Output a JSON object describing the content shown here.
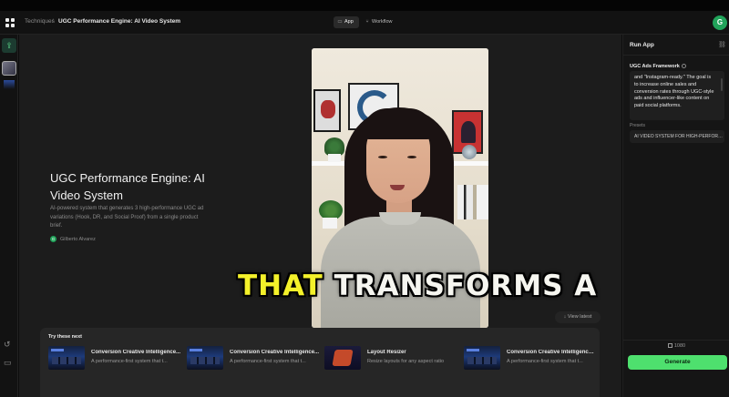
{
  "header": {
    "breadcrumb_parent": "Techniques",
    "breadcrumb_sep": "/",
    "breadcrumb_current": "UGC Performance Engine: AI Video System",
    "tabs": [
      {
        "label": "App",
        "icon": "phone-icon"
      },
      {
        "label": "Workflow",
        "icon": "workflow-icon"
      }
    ],
    "avatar_initial": "G"
  },
  "main": {
    "title": "UGC Performance Engine: AI Video System",
    "description": "AI-powered system that generates 3 high-performance UGC ad variations (Hook, DR, and Social Proof) from a single product brief.",
    "author_initial": "G",
    "author": "Gilberto Alvarez",
    "caption_highlight": "THAT",
    "caption_rest": " TRANSFORMS A",
    "view_latest": "View latest"
  },
  "try_next": {
    "title": "Try these next",
    "cards": [
      {
        "title": "Conversion Creative Intelligence...",
        "subtitle": "A performance-first system that t...",
        "thumb": "dashboard"
      },
      {
        "title": "Conversion Creative Intelligence...",
        "subtitle": "A performance-first system that t...",
        "thumb": "dashboard"
      },
      {
        "title": "Layout Resizer",
        "subtitle": "Resize layouts for any aspect ratio",
        "thumb": "layout"
      },
      {
        "title": "Conversion Creative Intelligence...",
        "subtitle": "A performance-first system that t...",
        "thumb": "dashboard"
      }
    ]
  },
  "right_panel": {
    "title": "Run App",
    "framework_label": "UGC Ads Framework",
    "framework_text": "and \"Instagram-ready.\" The goal is to increase online sales and conversion rates through UGC-style ads and influencer-like content on paid social platforms.",
    "presets_label": "Presets",
    "preset_value": "AI VIDEO SYSTEM FOR HIGH-PERFORM...",
    "credits": "1080",
    "generate_label": "Generate"
  },
  "colors": {
    "accent_green": "#4ee06e",
    "avatar_green": "#21a35a",
    "caption_highlight": "#f4f12a"
  }
}
